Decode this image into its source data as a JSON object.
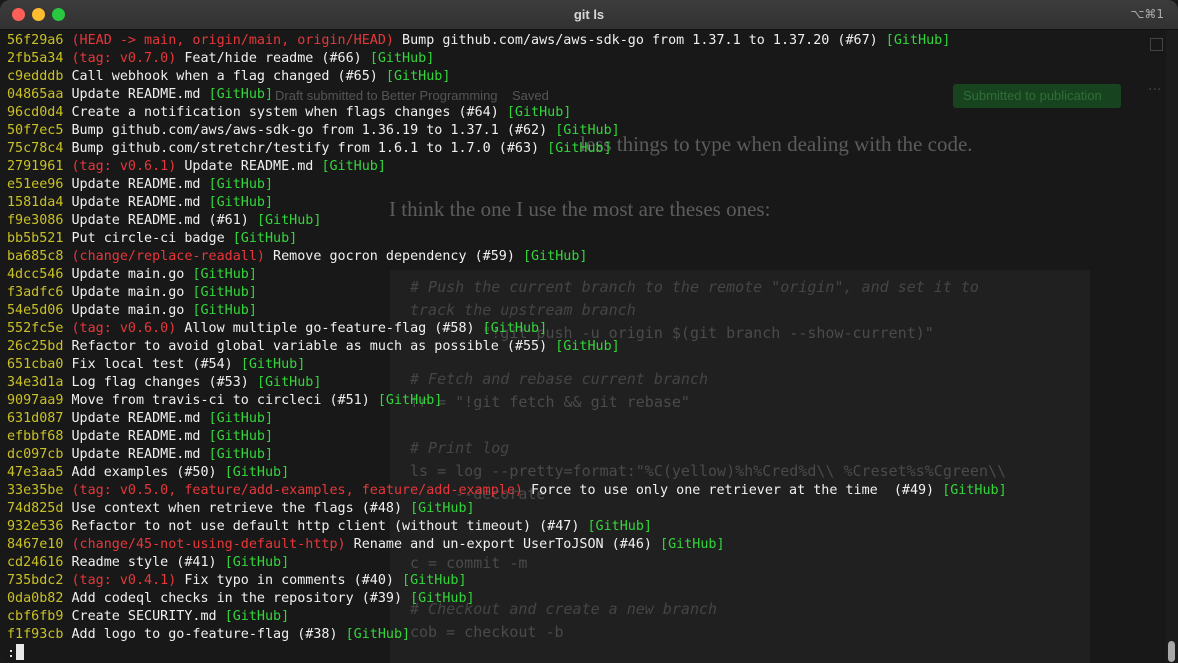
{
  "window": {
    "title": "git ls",
    "shortcut": "⌥⌘1"
  },
  "background": {
    "bar_text": "Draft submitted to Better Programming    Saved",
    "publish_button": "Submitted to publication",
    "more_icon": "···",
    "line1": "less things to type when dealing with the code.",
    "line2": "I think the one I use the most are theses ones:",
    "code": [
      {
        "t": "# Push the current branch to the remote \"origin\", and set it to",
        "c": "cm"
      },
      {
        "t": "track the upstream branch",
        "c": "cm"
      },
      {
        "t": "        \"!git push -u origin $(git branch --show-current)\"",
        "c": ""
      },
      {
        "t": "",
        "c": ""
      },
      {
        "t": "# Fetch and rebase current branch",
        "c": "cm"
      },
      {
        "t": "fr = \"!git fetch && git rebase\"",
        "c": ""
      },
      {
        "t": "",
        "c": ""
      },
      {
        "t": "# Print log",
        "c": "cm"
      },
      {
        "t": "ls = log --pretty=format:\"%C(yellow)%h%Cred%d\\\\ %Creset%s%Cgreen\\\\",
        "c": ""
      },
      {
        "t": "     --decorate",
        "c": ""
      },
      {
        "t": "",
        "c": ""
      },
      {
        "t": "",
        "c": ""
      },
      {
        "t": "c = commit -m",
        "c": ""
      },
      {
        "t": "",
        "c": ""
      },
      {
        "t": "# Checkout and create a new branch",
        "c": "cm"
      },
      {
        "t": "cob = checkout -b",
        "c": ""
      }
    ]
  },
  "log": [
    {
      "hash": "56f29a6",
      "refs": "(HEAD -> main, origin/main, origin/HEAD)",
      "msg": "Bump github.com/aws/aws-sdk-go from 1.37.1 to 1.37.20 (#67)",
      "src": "[GitHub]"
    },
    {
      "hash": "2fb5a34",
      "refs": "(tag: v0.7.0)",
      "msg": "Feat/hide readme (#66)",
      "src": "[GitHub]"
    },
    {
      "hash": "c9edddb",
      "refs": "",
      "msg": "Call webhook when a flag changed (#65)",
      "src": "[GitHub]"
    },
    {
      "hash": "04865aa",
      "refs": "",
      "msg": "Update README.md",
      "src": "[GitHub]"
    },
    {
      "hash": "96cd0d4",
      "refs": "",
      "msg": "Create a notification system when flags changes (#64)",
      "src": "[GitHub]"
    },
    {
      "hash": "50f7ec5",
      "refs": "",
      "msg": "Bump github.com/aws/aws-sdk-go from 1.36.19 to 1.37.1 (#62)",
      "src": "[GitHub]"
    },
    {
      "hash": "75c78c4",
      "refs": "",
      "msg": "Bump github.com/stretchr/testify from 1.6.1 to 1.7.0 (#63)",
      "src": "[GitHub]"
    },
    {
      "hash": "2791961",
      "refs": "(tag: v0.6.1)",
      "msg": "Update README.md",
      "src": "[GitHub]"
    },
    {
      "hash": "e51ee96",
      "refs": "",
      "msg": "Update README.md",
      "src": "[GitHub]"
    },
    {
      "hash": "1581da4",
      "refs": "",
      "msg": "Update README.md",
      "src": "[GitHub]"
    },
    {
      "hash": "f9e3086",
      "refs": "",
      "msg": "Update README.md (#61)",
      "src": "[GitHub]"
    },
    {
      "hash": "bb5b521",
      "refs": "",
      "msg": "Put circle-ci badge",
      "src": "[GitHub]"
    },
    {
      "hash": "ba685c8",
      "refs": "(change/replace-readall)",
      "msg": "Remove gocron dependency (#59)",
      "src": "[GitHub]"
    },
    {
      "hash": "4dcc546",
      "refs": "",
      "msg": "Update main.go",
      "src": "[GitHub]"
    },
    {
      "hash": "f3adfc6",
      "refs": "",
      "msg": "Update main.go",
      "src": "[GitHub]"
    },
    {
      "hash": "54e5d06",
      "refs": "",
      "msg": "Update main.go",
      "src": "[GitHub]"
    },
    {
      "hash": "552fc5e",
      "refs": "(tag: v0.6.0)",
      "msg": "Allow multiple go-feature-flag (#58)",
      "src": "[GitHub]"
    },
    {
      "hash": "26c25bd",
      "refs": "",
      "msg": "Refactor to avoid global variable as much as possible (#55)",
      "src": "[GitHub]"
    },
    {
      "hash": "651cba0",
      "refs": "",
      "msg": "Fix local test (#54)",
      "src": "[GitHub]"
    },
    {
      "hash": "34e3d1a",
      "refs": "",
      "msg": "Log flag changes (#53)",
      "src": "[GitHub]"
    },
    {
      "hash": "9097aa9",
      "refs": "",
      "msg": "Move from travis-ci to circleci (#51)",
      "src": "[GitHub]"
    },
    {
      "hash": "631d087",
      "refs": "",
      "msg": "Update README.md",
      "src": "[GitHub]"
    },
    {
      "hash": "efbbf68",
      "refs": "",
      "msg": "Update README.md",
      "src": "[GitHub]"
    },
    {
      "hash": "dc097cb",
      "refs": "",
      "msg": "Update README.md",
      "src": "[GitHub]"
    },
    {
      "hash": "47e3aa5",
      "refs": "",
      "msg": "Add examples (#50)",
      "src": "[GitHub]"
    },
    {
      "hash": "33e35be",
      "refs": "(tag: v0.5.0, feature/add-examples, feature/add-example)",
      "msg": "Force to use only one retriever at the time  (#49)",
      "src": "[GitHub]"
    },
    {
      "hash": "74d825d",
      "refs": "",
      "msg": "Use context when retrieve the flags (#48)",
      "src": "[GitHub]"
    },
    {
      "hash": "932e536",
      "refs": "",
      "msg": "Refactor to not use default http client (without timeout) (#47)",
      "src": "[GitHub]"
    },
    {
      "hash": "8467e10",
      "refs": "(change/45-not-using-default-http)",
      "msg": "Rename and un-export UserToJSON (#46)",
      "src": "[GitHub]"
    },
    {
      "hash": "cd24616",
      "refs": "",
      "msg": "Readme style (#41)",
      "src": "[GitHub]"
    },
    {
      "hash": "735bdc2",
      "refs": "(tag: v0.4.1)",
      "msg": "Fix typo in comments (#40)",
      "src": "[GitHub]"
    },
    {
      "hash": "0da0b82",
      "refs": "",
      "msg": "Add codeql checks in the repository (#39)",
      "src": "[GitHub]"
    },
    {
      "hash": "cbf6fb9",
      "refs": "",
      "msg": "Create SECURITY.md",
      "src": "[GitHub]"
    },
    {
      "hash": "f1f93cb",
      "refs": "",
      "msg": "Add logo to go-feature-flag (#38)",
      "src": "[GitHub]"
    }
  ],
  "prompt": ":"
}
